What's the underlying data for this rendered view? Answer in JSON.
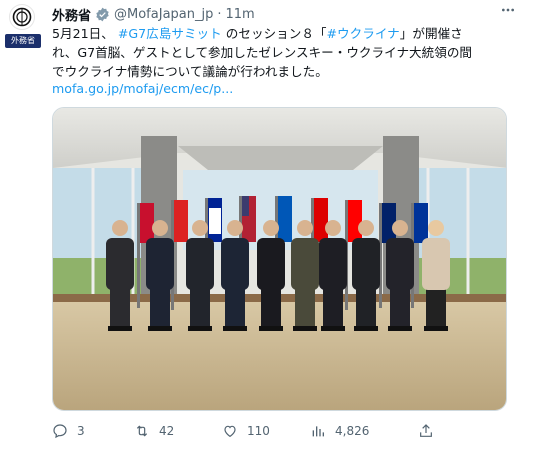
{
  "author": {
    "name": "外務省",
    "handle": "@MofaJapan_jp",
    "separator": "·",
    "time": "11m",
    "avatar_label": "外務省"
  },
  "tweet": {
    "line1_prefix": "5月21日、",
    "hashtag1": "#G7広島サミット",
    "line1_middle": "のセッション８「",
    "hashtag2": "#ウクライナ",
    "line1_suffix": "」が開催さ",
    "line2": "れ、G7首脳、ゲストとして参加したゼレンスキー・ウクライナ大統領の間",
    "line3": "でウクライナ情勢について議論が行われました。",
    "link": "mofa.go.jp/mofaj/ecm/ec/p..."
  },
  "metrics": {
    "replies": "3",
    "retweets": "42",
    "likes": "110",
    "views": "4,826"
  },
  "icons": [
    "verified-badge-icon",
    "more-icon",
    "reply-icon",
    "retweet-icon",
    "like-icon",
    "views-icon",
    "share-icon"
  ],
  "colors": {
    "accent": "#1d9bf0",
    "muted": "#536471",
    "verified": "#829aab"
  }
}
